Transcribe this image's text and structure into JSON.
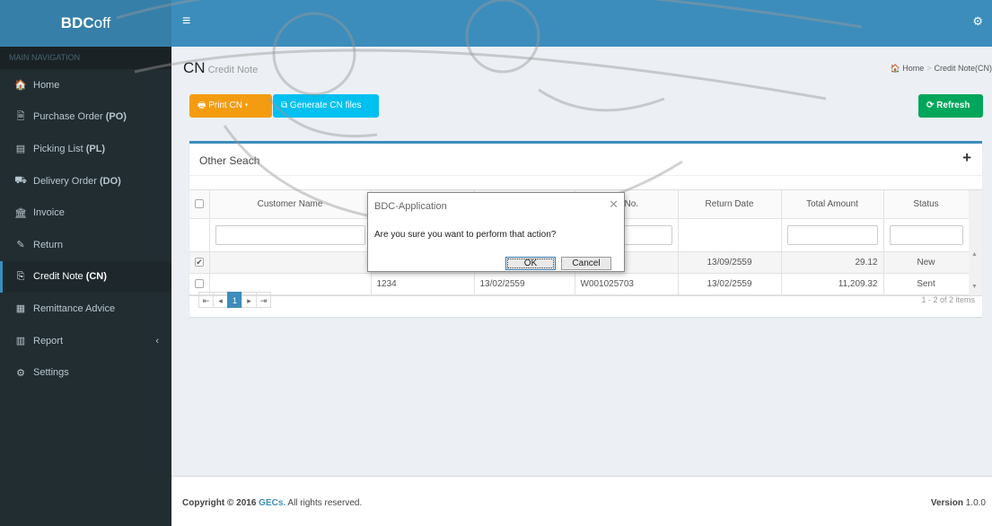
{
  "app": {
    "logo_bold": "BDC",
    "logo_light": "off"
  },
  "sidebar": {
    "header": "MAIN NAVIGATION",
    "items": [
      {
        "icon": "🏠",
        "label": "Home",
        "code": ""
      },
      {
        "icon": "🗎",
        "label": "Purchase Order ",
        "code": "(PO)"
      },
      {
        "icon": "▤",
        "label": "Picking List ",
        "code": "(PL)"
      },
      {
        "icon": "⛟",
        "label": "Delivery Order ",
        "code": "(DO)"
      },
      {
        "icon": "🏛",
        "label": "Invoice",
        "code": ""
      },
      {
        "icon": "✎",
        "label": "Return",
        "code": ""
      },
      {
        "icon": "⎘",
        "label": "Credit Note ",
        "code": "(CN)"
      },
      {
        "icon": "▦",
        "label": "Remittance Advice",
        "code": ""
      },
      {
        "icon": "▥",
        "label": "Report",
        "code": "",
        "caret": "‹"
      },
      {
        "icon": "⚙",
        "label": "Settings",
        "code": ""
      }
    ],
    "active_index": 6
  },
  "topbar": {
    "toggle_icon": "≡",
    "gear_icon": "⚙"
  },
  "page": {
    "title": "CN",
    "subtitle": "Credit Note"
  },
  "breadcrumb": {
    "home_icon": "🏠",
    "home": "Home",
    "sep": ">",
    "current": "Credit Note(CN)"
  },
  "toolbar": {
    "print_label": "🖶 Print CN ▾",
    "generate_label": "⧉ Generate CN files",
    "refresh_label": "⟳ Refresh"
  },
  "box": {
    "title": "Other Seach",
    "expand_icon": "+"
  },
  "grid": {
    "columns": [
      "",
      "Customer Name",
      "",
      "",
      "rn No.",
      "Return Date",
      "Total Amount",
      "Status"
    ],
    "rows": [
      {
        "checked": true,
        "customer": "",
        "c3": "",
        "c4": "",
        "return_no": "5",
        "return_date": "13/09/2559",
        "total": "29.12",
        "status": "New"
      },
      {
        "checked": false,
        "customer": "",
        "c3": "1234",
        "c4": "13/02/2559",
        "return_no": "W001025703",
        "return_date": "13/02/2559",
        "total": "11,209.32",
        "status": "Sent"
      }
    ],
    "scroll_up": "▲",
    "scroll_down": "▼"
  },
  "pager": {
    "first": "⇤",
    "prev": "◂",
    "page": "1",
    "next": "▸",
    "last": "⇥",
    "info": "1 - 2 of 2 items"
  },
  "footer": {
    "copy_prefix": "Copyright © 2016 ",
    "company": "GECs.",
    "copy_suffix": " All rights reserved.",
    "version_label": "Version",
    "version": "1.0.0"
  },
  "dialog": {
    "title": "BDC-Application",
    "close_icon": "✕",
    "message": "Are you sure you want to perform that action?",
    "ok": "OK",
    "cancel": "Cancel"
  }
}
